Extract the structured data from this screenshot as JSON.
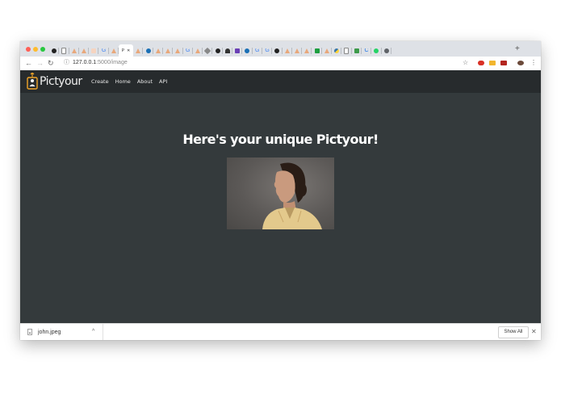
{
  "browser": {
    "active_tab_label": "P",
    "url_host": "127.0.0.1",
    "url_path": ":5000/image",
    "new_tab_symbol": "+"
  },
  "site": {
    "brand": "Pictyour",
    "nav": [
      "Create",
      "Home",
      "About",
      "API"
    ],
    "heading": "Here's your unique Pictyour!",
    "image_alt_icon": "portrait-photo"
  },
  "downloads": {
    "file_name": "john.jpeg",
    "show_all_label": "Show All"
  },
  "colors": {
    "page_bg": "#343a3c",
    "navbar_bg": "#272b2d",
    "brand_accent": "#f0a528"
  }
}
